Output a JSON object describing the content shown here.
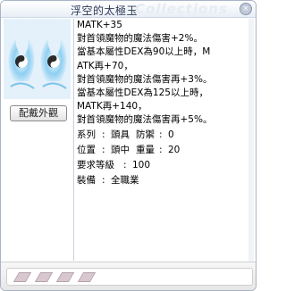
{
  "window": {
    "title": "浮空的太極玉",
    "watermark": "Collections",
    "close_label": "×"
  },
  "buttons": {
    "appearance": "配戴外觀"
  },
  "description": [
    "MATK+35",
    "對首領魔物的魔法傷害+2%。",
    "當基本屬性DEX為90以上時，M",
    "ATK再+70，",
    "對首領魔物的魔法傷害再+3%。",
    "當基本屬性DEX為125以上時，",
    "MATK再+140，",
    "對首領魔物的魔法傷害再+5%。"
  ],
  "stats": {
    "type_label": "系列",
    "type_value": "頭具",
    "defense_label": "防禦",
    "defense_value": "0",
    "position_label": "位置",
    "position_value": "頭中",
    "weight_label": "重量",
    "weight_value": "20",
    "level_label": "要求等級",
    "level_value": "100",
    "equip_label": "裝備",
    "equip_value": "全職業"
  },
  "slots": {
    "count": 4
  }
}
